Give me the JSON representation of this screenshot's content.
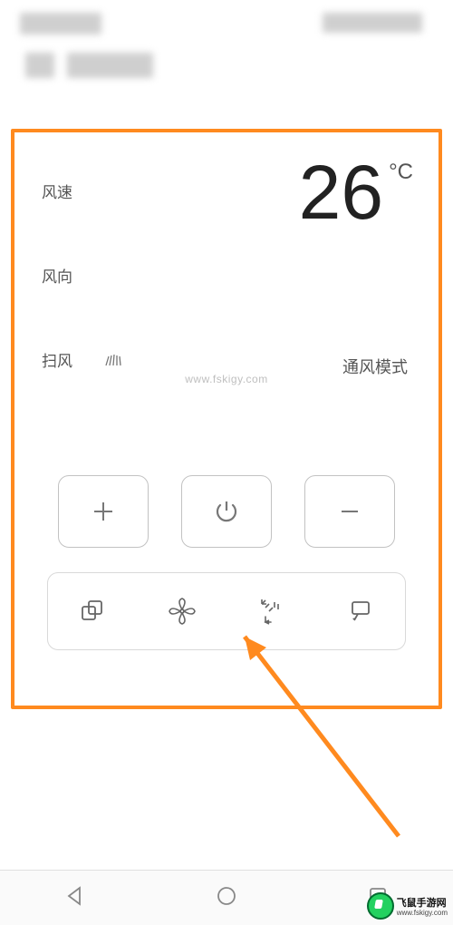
{
  "labels": {
    "fan_speed": "风速",
    "fan_direction": "风向",
    "sweep": "扫风"
  },
  "temperature": {
    "value": "26",
    "unit": "°C"
  },
  "mode": {
    "label": "通风模式"
  },
  "buttons": {
    "plus": "plus-icon",
    "power": "power-icon",
    "minus": "minus-icon"
  },
  "options": {
    "mode": "mode-icon",
    "fan": "fan-icon",
    "sweep": "sweep-icon",
    "swing": "swing-icon"
  },
  "watermark": {
    "brand": "飞鼠手游网",
    "url": "www.fskigy.com"
  },
  "center_watermark": "www.fskigy.com"
}
